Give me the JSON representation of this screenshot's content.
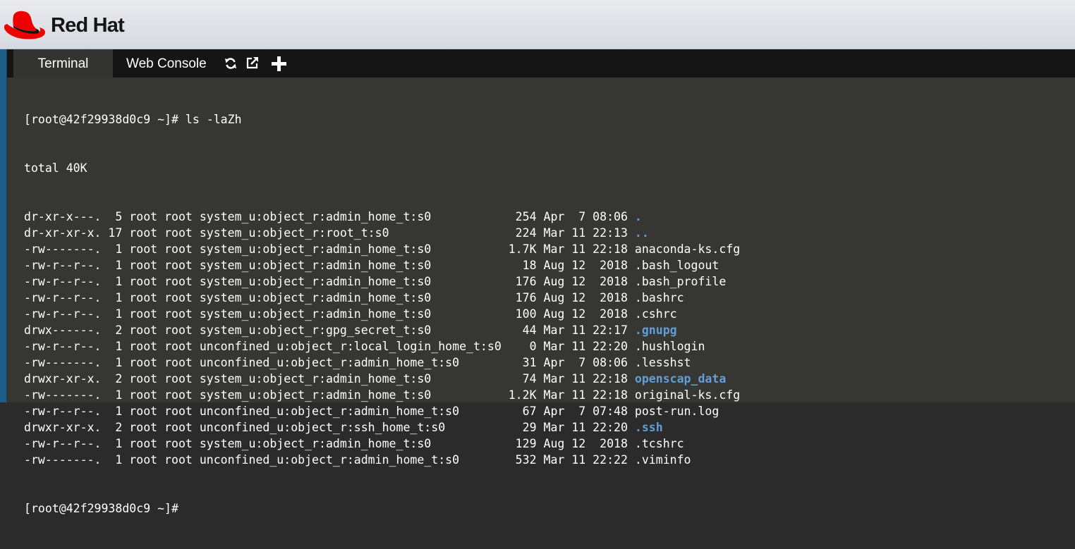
{
  "header": {
    "brand": "Red Hat"
  },
  "tabs": [
    {
      "label": "Terminal",
      "active": true
    },
    {
      "label": "Web Console",
      "active": false
    }
  ],
  "toolbar_icons": [
    "refresh-icon",
    "external-link-icon",
    "plus-icon"
  ],
  "colors": {
    "accent": "#1c5f8a",
    "directory": "#639ed8",
    "brand_red": "#ee0000",
    "terminal_bg": "#363632"
  },
  "terminal": {
    "command_line": "[root@42f29938d0c9 ~]# ls -laZh",
    "total_line": "total 40K",
    "entries": [
      {
        "meta": "dr-xr-x---.  5 root root system_u:object_r:admin_home_t:s0            254 Apr  7 08:06 ",
        "name": ".",
        "is_dir": true
      },
      {
        "meta": "dr-xr-xr-x. 17 root root system_u:object_r:root_t:s0                  224 Mar 11 22:13 ",
        "name": "..",
        "is_dir": true
      },
      {
        "meta": "-rw-------.  1 root root system_u:object_r:admin_home_t:s0           1.7K Mar 11 22:18 ",
        "name": "anaconda-ks.cfg",
        "is_dir": false
      },
      {
        "meta": "-rw-r--r--.  1 root root system_u:object_r:admin_home_t:s0             18 Aug 12  2018 ",
        "name": ".bash_logout",
        "is_dir": false
      },
      {
        "meta": "-rw-r--r--.  1 root root system_u:object_r:admin_home_t:s0            176 Aug 12  2018 ",
        "name": ".bash_profile",
        "is_dir": false
      },
      {
        "meta": "-rw-r--r--.  1 root root system_u:object_r:admin_home_t:s0            176 Aug 12  2018 ",
        "name": ".bashrc",
        "is_dir": false
      },
      {
        "meta": "-rw-r--r--.  1 root root system_u:object_r:admin_home_t:s0            100 Aug 12  2018 ",
        "name": ".cshrc",
        "is_dir": false
      },
      {
        "meta": "drwx------.  2 root root system_u:object_r:gpg_secret_t:s0             44 Mar 11 22:17 ",
        "name": ".gnupg",
        "is_dir": true
      },
      {
        "meta": "-rw-r--r--.  1 root root unconfined_u:object_r:local_login_home_t:s0    0 Mar 11 22:20 ",
        "name": ".hushlogin",
        "is_dir": false
      },
      {
        "meta": "-rw-------.  1 root root unconfined_u:object_r:admin_home_t:s0         31 Apr  7 08:06 ",
        "name": ".lesshst",
        "is_dir": false
      },
      {
        "meta": "drwxr-xr-x.  2 root root system_u:object_r:admin_home_t:s0             74 Mar 11 22:18 ",
        "name": "openscap_data",
        "is_dir": true
      },
      {
        "meta": "-rw-------.  1 root root system_u:object_r:admin_home_t:s0           1.2K Mar 11 22:18 ",
        "name": "original-ks.cfg",
        "is_dir": false
      },
      {
        "meta": "-rw-r--r--.  1 root root unconfined_u:object_r:admin_home_t:s0         67 Apr  7 07:48 ",
        "name": "post-run.log",
        "is_dir": false
      },
      {
        "meta": "drwxr-xr-x.  2 root root unconfined_u:object_r:ssh_home_t:s0           29 Mar 11 22:20 ",
        "name": ".ssh",
        "is_dir": true
      },
      {
        "meta": "-rw-r--r--.  1 root root system_u:object_r:admin_home_t:s0            129 Aug 12  2018 ",
        "name": ".tcshrc",
        "is_dir": false
      },
      {
        "meta": "-rw-------.  1 root root unconfined_u:object_r:admin_home_t:s0        532 Mar 11 22:22 ",
        "name": ".viminfo",
        "is_dir": false
      }
    ],
    "prompt": "[root@42f29938d0c9 ~]#"
  }
}
